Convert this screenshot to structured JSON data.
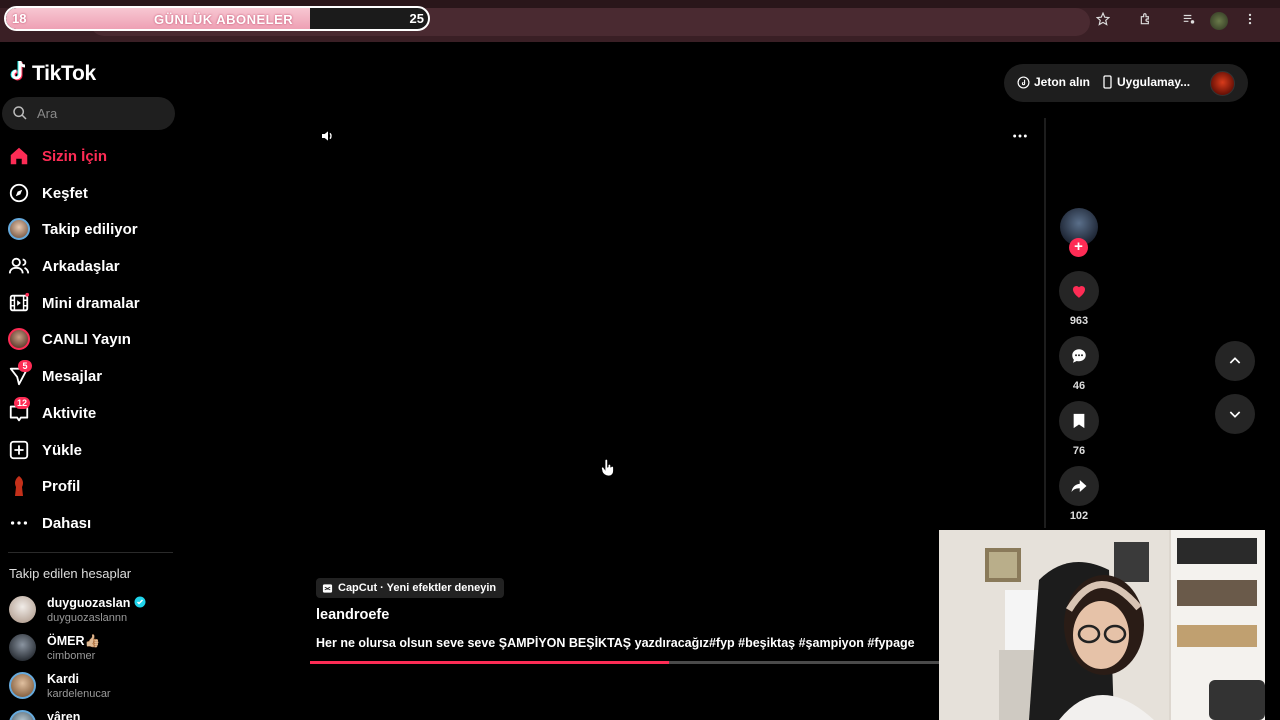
{
  "browser": {
    "sub_overlay": {
      "left_number": "18",
      "title": "GÜNLÜK ABONELER",
      "right_number": "25",
      "progress_fraction": 0.72
    },
    "icons": [
      "star-icon",
      "extensions-icon",
      "media-control-icon",
      "profile-icon",
      "kebab-menu-icon"
    ]
  },
  "brand": {
    "name": "TikTok"
  },
  "search": {
    "placeholder": "Ara"
  },
  "nav": {
    "items": [
      {
        "label": "Sizin İçin",
        "icon": "home-icon",
        "active": true
      },
      {
        "label": "Keşfet",
        "icon": "compass-icon"
      },
      {
        "label": "Takip ediliyor",
        "icon": "following-avatar"
      },
      {
        "label": "Arkadaşlar",
        "icon": "friends-icon"
      },
      {
        "label": "Mini dramalar",
        "icon": "film-icon"
      },
      {
        "label": "CANLI Yayın",
        "icon": "live-avatar"
      },
      {
        "label": "Mesajlar",
        "icon": "messages-icon",
        "badge": "5"
      },
      {
        "label": "Aktivite",
        "icon": "activity-icon",
        "badge": "12"
      },
      {
        "label": "Yükle",
        "icon": "upload-icon"
      },
      {
        "label": "Profil",
        "icon": "profile-avatar"
      },
      {
        "label": "Dahası",
        "icon": "more-icon"
      }
    ]
  },
  "followed": {
    "title": "Takip edilen hesaplar",
    "accounts": [
      {
        "name": "duyguozaslan",
        "handle": "duyguozaslannn",
        "verified": true,
        "avatar_color": "#e9e0da"
      },
      {
        "name": "ÖMER👍🏼",
        "handle": "cimbomer",
        "verified": false,
        "avatar_color": "#3a3f48"
      },
      {
        "name": "Kardi",
        "handle": "kardelenucar",
        "verified": false,
        "avatar_color": "#c9a27a"
      },
      {
        "name": "yâren",
        "handle": "",
        "verified": false,
        "avatar_color": "#8aa0b0"
      }
    ]
  },
  "header_pill": {
    "coins_label": "Jeton alın",
    "app_label": "Uygulamay..."
  },
  "video": {
    "capcut_label": "CapCut · Yeni efektler deneyin",
    "author": "leandroefe",
    "caption": "Her ne olursa olsun seve seve ŞAMPİYON BEŞİKTAŞ yazdıracağız#fyp #beşiktaş #şampiyon #fypage",
    "progress_fraction": 0.57
  },
  "actions": {
    "likes": "963",
    "comments": "46",
    "saves": "76",
    "shares": "102"
  },
  "colors": {
    "accent": "#fe2c55",
    "background": "#000000",
    "browser_bar": "#3a1f25"
  }
}
